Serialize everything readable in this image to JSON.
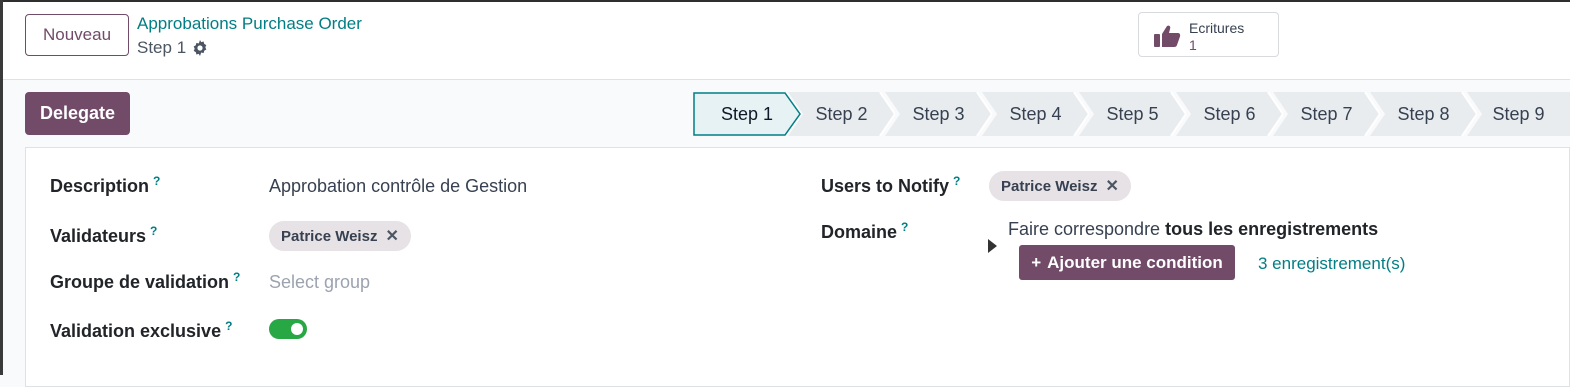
{
  "header": {
    "new_button": "Nouveau",
    "breadcrumb_parent": "Approbations Purchase Order",
    "breadcrumb_current": "Step 1",
    "smart_button": {
      "label": "Ecritures",
      "value": "1",
      "icon": "thumbs-up-icon"
    }
  },
  "actions": {
    "delegate": "Delegate"
  },
  "steps": [
    {
      "label": "Step 1",
      "active": true
    },
    {
      "label": "Step 2"
    },
    {
      "label": "Step 3"
    },
    {
      "label": "Step 4"
    },
    {
      "label": "Step 5"
    },
    {
      "label": "Step 6"
    },
    {
      "label": "Step 7"
    },
    {
      "label": "Step 8"
    },
    {
      "label": "Step 9"
    }
  ],
  "form": {
    "description": {
      "label": "Description",
      "help": "?",
      "value": "Approbation contrôle de Gestion"
    },
    "validators": {
      "label": "Validateurs",
      "help": "?",
      "tag": "Patrice Weisz",
      "remove": "✕"
    },
    "group": {
      "label": "Groupe de validation",
      "help": "?",
      "placeholder": "Select group"
    },
    "exclusive": {
      "label": "Validation exclusive",
      "help": "?",
      "enabled": true
    },
    "notify": {
      "label": "Users to Notify",
      "help": "?",
      "tag": "Patrice Weisz",
      "remove": "✕"
    },
    "domain": {
      "label": "Domaine",
      "help": "?",
      "text_prefix": "Faire correspondre ",
      "text_bold": "tous les enregistrements",
      "add_condition": "Ajouter une condition",
      "add_icon": "+",
      "records": "3 enregistrement(s)"
    }
  },
  "colors": {
    "primary": "#714b67",
    "teal": "#017e84",
    "toggle_on": "#28a745"
  }
}
